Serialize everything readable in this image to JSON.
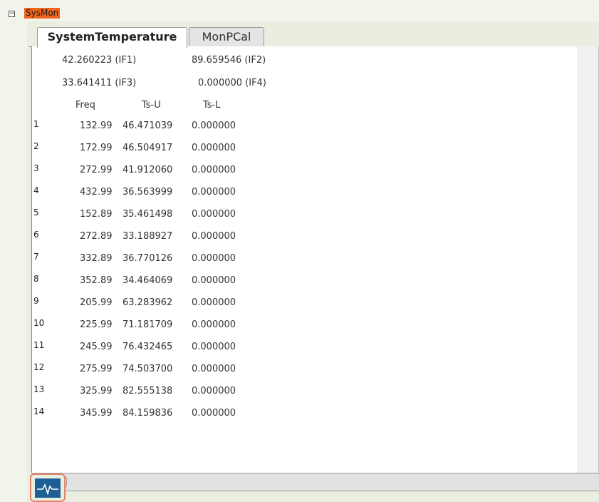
{
  "tree": {
    "node_label": "SysMon",
    "collapse_symbol": "−"
  },
  "tabs": [
    {
      "label": "SystemTemperature",
      "active": true
    },
    {
      "label": "MonPCal",
      "active": false
    }
  ],
  "summary": [
    {
      "value": "42.260223",
      "tag": "(IF1)"
    },
    {
      "value": "89.659546",
      "tag": "(IF2)"
    },
    {
      "value": "33.641411",
      "tag": "(IF3)"
    },
    {
      "value": "0.000000",
      "tag": "(IF4)"
    }
  ],
  "summary_text": {
    "if1": "42.260223 (IF1)",
    "if2": "89.659546 (IF2)",
    "if3": "33.641411 (IF3)",
    "if4": "0.000000 (IF4)"
  },
  "table": {
    "columns": [
      "Freq",
      "Ts-U",
      "Ts-L"
    ],
    "rows": [
      {
        "index": "1",
        "freq": "132.99",
        "ts_u": "46.471039",
        "ts_l": "0.000000"
      },
      {
        "index": "2",
        "freq": "172.99",
        "ts_u": "46.504917",
        "ts_l": "0.000000"
      },
      {
        "index": "3",
        "freq": "272.99",
        "ts_u": "41.912060",
        "ts_l": "0.000000"
      },
      {
        "index": "4",
        "freq": "432.99",
        "ts_u": "36.563999",
        "ts_l": "0.000000"
      },
      {
        "index": "5",
        "freq": "152.89",
        "ts_u": "35.461498",
        "ts_l": "0.000000"
      },
      {
        "index": "6",
        "freq": "272.89",
        "ts_u": "33.188927",
        "ts_l": "0.000000"
      },
      {
        "index": "7",
        "freq": "332.89",
        "ts_u": "36.770126",
        "ts_l": "0.000000"
      },
      {
        "index": "8",
        "freq": "352.89",
        "ts_u": "34.464069",
        "ts_l": "0.000000"
      },
      {
        "index": "9",
        "freq": "205.99",
        "ts_u": "63.283962",
        "ts_l": "0.000000"
      },
      {
        "index": "10",
        "freq": "225.99",
        "ts_u": "71.181709",
        "ts_l": "0.000000"
      },
      {
        "index": "11",
        "freq": "245.99",
        "ts_u": "76.432465",
        "ts_l": "0.000000"
      },
      {
        "index": "12",
        "freq": "275.99",
        "ts_u": "74.503700",
        "ts_l": "0.000000"
      },
      {
        "index": "13",
        "freq": "325.99",
        "ts_u": "82.555138",
        "ts_l": "0.000000"
      },
      {
        "index": "14",
        "freq": "345.99",
        "ts_u": "84.159836",
        "ts_l": "0.000000"
      }
    ]
  },
  "icons": {
    "collapse": "minus-box-icon",
    "monitor": "heartbeat-monitor-icon"
  },
  "colors": {
    "node_highlight": "#f0651c",
    "active_tab": "#ffffff",
    "monitor_screen": "#1e5f93",
    "monitor_border": "#e0856a"
  }
}
